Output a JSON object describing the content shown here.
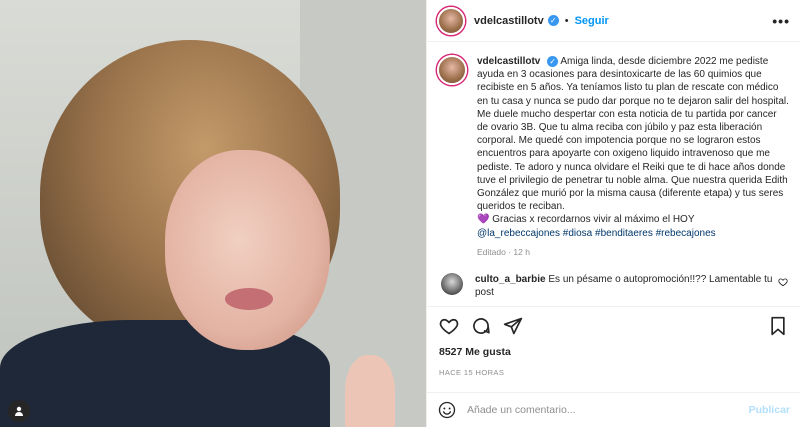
{
  "post": {
    "author": "vdelcastillotv",
    "follow_label": "Seguir",
    "separator": "•",
    "more_label": "•••",
    "caption": "Amiga linda, desde diciembre 2022 me pediste ayuda en 3 ocasiones para desintoxicarte de las 60 quimios que recibiste en 5 años. Ya teníamos listo tu plan de rescate con médico en tu casa y nunca se pudo dar porque no te dejaron salir del hospital. Me duele mucho despertar con esta noticia de tu partida por cancer de ovario 3B. Que tu alma reciba con júbilo y paz esta liberación corporal. Me quedé con impotencia porque no se lograron estos encuentros para apoyarte con oxigeno liquido intravenoso que me pediste. Te adoro y nunca olvidare el Reiki que te di hace años donde tuve el privilegio de penetrar tu noble alma. Que nuestra querida Edith González que murió por la misma causa (diferente etapa) y tus seres queridos te reciban.",
    "caption_end": "💜 Gracias x recordarnos vivir al máximo el HOY",
    "hashtags": "@la_rebeccajones #diosa #benditaeres #rebecajones",
    "edited_label": "Editado · 12 h",
    "likes": "8527 Me gusta",
    "time_ago": "HACE 15 HORAS"
  },
  "comment": {
    "username": "culto_a_barbie",
    "text": "Es un pésame o autopromoción!!?? Lamentable tu post"
  },
  "add_comment": {
    "placeholder": "Añade un comentario...",
    "publish_label": "Publicar"
  },
  "icons": [
    "more-icon",
    "verified-icon",
    "heart-icon",
    "comment-icon",
    "share-icon",
    "bookmark-icon",
    "emoji-icon",
    "tag-user-icon"
  ],
  "colors": {
    "accent": "#0095f6",
    "verified": "#3897f0",
    "publish_disabled": "#b2dffc",
    "hashtag": "#00376b"
  }
}
